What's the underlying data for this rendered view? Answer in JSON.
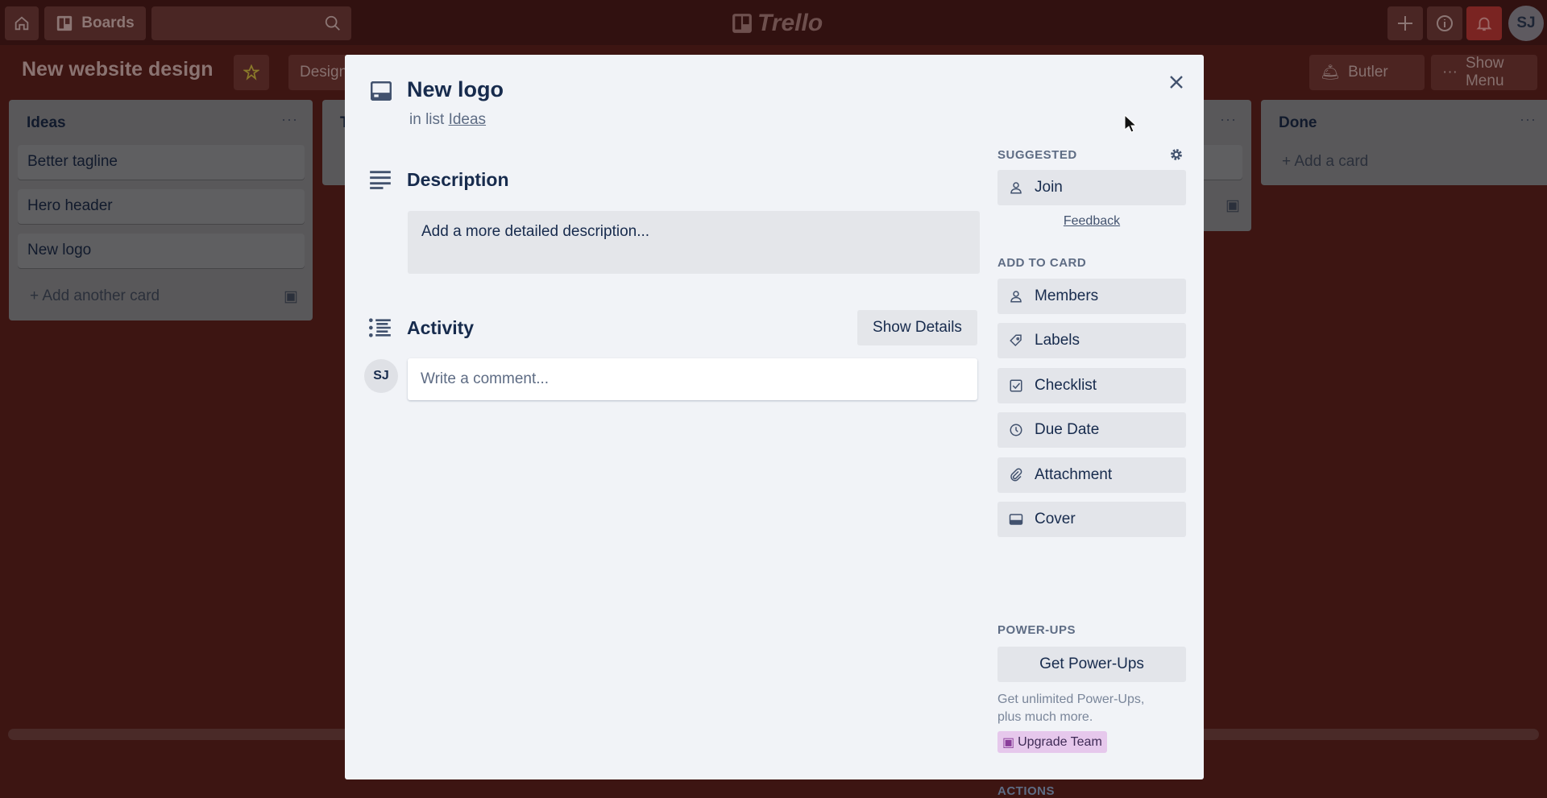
{
  "topbar": {
    "boards_label": "Boards",
    "search_placeholder": "",
    "logo_text": "Trello",
    "avatar_initials": "SJ"
  },
  "board": {
    "title": "New website design",
    "filter_label": "Design",
    "butler_label": "Butler",
    "show_menu_label": "Show Menu"
  },
  "lists": [
    {
      "title": "Ideas",
      "cards": [
        "Better tagline",
        "Hero header",
        "New logo"
      ],
      "add_label": "Add another card"
    },
    {
      "title": "T"
    },
    {
      "title": ""
    },
    {
      "title": "Done",
      "cards": [],
      "add_label": "Add a card"
    }
  ],
  "modal": {
    "title": "New logo",
    "in_list_prefix": "in list",
    "list_name": "Ideas",
    "description_heading": "Description",
    "description_placeholder": "Add a more detailed description...",
    "activity_heading": "Activity",
    "show_details_label": "Show Details",
    "comment_avatar": "SJ",
    "comment_placeholder": "Write a comment...",
    "suggested_label": "SUGGESTED",
    "join_label": "Join",
    "feedback_label": "Feedback",
    "add_to_card_label": "ADD TO CARD",
    "add_to_card": [
      {
        "label": "Members",
        "icon": "person-icon"
      },
      {
        "label": "Labels",
        "icon": "tag-icon"
      },
      {
        "label": "Checklist",
        "icon": "checkbox-icon"
      },
      {
        "label": "Due Date",
        "icon": "clock-icon"
      },
      {
        "label": "Attachment",
        "icon": "paperclip-icon"
      },
      {
        "label": "Cover",
        "icon": "cover-icon"
      }
    ],
    "powerups_label": "POWER-UPS",
    "get_powerups_label": "Get Power-Ups",
    "powerups_text_1": "Get unlimited Power-Ups,",
    "powerups_text_2": "plus much more.",
    "upgrade_label": "Upgrade Team",
    "actions_label": "ACTIONS"
  },
  "colors": {
    "overlay_board": "#3d1512",
    "modal_bg": "#f1f3f7",
    "upgrade_bg": "#e6c8ec",
    "bell_bg": "#7a2422"
  }
}
